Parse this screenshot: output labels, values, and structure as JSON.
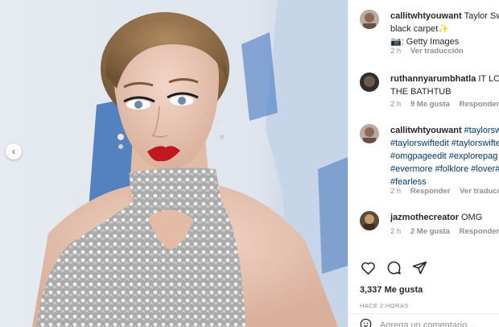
{
  "post": {
    "caption": {
      "username": "callitwhtyouwant",
      "line1": "Taylor Swi",
      "line2": "black carpet",
      "line2_emoji": "✨",
      "line3": "📷: Getty Images",
      "time": "2 h",
      "translate": "Ver traducción"
    },
    "comments": [
      {
        "username": "ruthannyarumbhatla",
        "line1": "IT LOC",
        "line2": "THE BATHTUB",
        "time": "2 h",
        "likes": "9 Me gusta",
        "reply": "Responder"
      },
      {
        "username": "callitwhtyouwant",
        "line1": "#taylorswi",
        "line2": "#taylorswiftedit #taylorswifte",
        "line3": "#omgpageedit #explorepag",
        "line4": "#evermore #folklore #lover#",
        "line5": "#fearless",
        "time": "2 h",
        "reply": "Responder",
        "translate": "Ver traducció"
      },
      {
        "username": "jazmothecreator",
        "line1": "OMG",
        "time": "2 h",
        "likes": "2 Me gusta",
        "reply": "Responder"
      }
    ],
    "likes_count": "3,337 Me gusta",
    "time_ago": "HACE 2 HORAS",
    "add_comment_placeholder": "Agrega un comentario..."
  },
  "colors": {
    "hashtag": "#00376b",
    "secondary": "#8e8e8e",
    "lips": "#c0181f"
  },
  "icons": [
    "chevron-left-icon",
    "heart-icon",
    "comment-icon",
    "share-icon",
    "emoji-icon"
  ]
}
